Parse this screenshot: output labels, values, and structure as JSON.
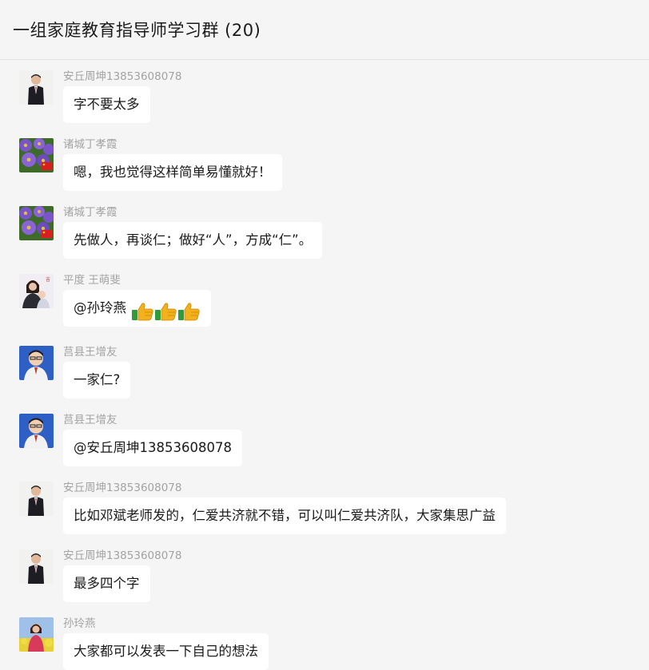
{
  "window": {
    "title": "一组家庭教育指导师学习群 (20)"
  },
  "messages": [
    {
      "sender": "安丘周坤13853608078",
      "text": "字不要太多",
      "avatar": "man-suit-avatar"
    },
    {
      "sender": "诸城丁孝霞",
      "text": "嗯，我也觉得这样简单易懂就好！",
      "avatar": "purple-flower-avatar"
    },
    {
      "sender": "诸城丁孝霞",
      "text": "先做人，再谈仁；做好“人”，方成“仁”。",
      "avatar": "purple-flower-avatar"
    },
    {
      "sender": "平度 王萌斐",
      "text": "@孙玲燕",
      "avatar": "mother-child-avatar",
      "emoji": [
        "thumbs-up-emoji",
        "thumbs-up-emoji",
        "thumbs-up-emoji"
      ]
    },
    {
      "sender": "莒县王增友",
      "text": "一家仁?",
      "avatar": "man-portrait-blue-avatar"
    },
    {
      "sender": "莒县王增友",
      "text": "@安丘周坤13853608078",
      "avatar": "man-portrait-blue-avatar"
    },
    {
      "sender": "安丘周坤13853608078",
      "text": "比如邓斌老师发的，仁爱共济就不错，可以叫仁爱共济队，大家集思广益",
      "avatar": "man-suit-avatar"
    },
    {
      "sender": "安丘周坤13853608078",
      "text": "最多四个字",
      "avatar": "man-suit-avatar"
    },
    {
      "sender": "孙玲燕",
      "text": "大家都可以发表一下自己的想法",
      "avatar": "woman-flowers-avatar"
    }
  ],
  "colors": {
    "background": "#f5f5f5",
    "bubble": "#ffffff",
    "sender_text": "#a3a3a3"
  }
}
